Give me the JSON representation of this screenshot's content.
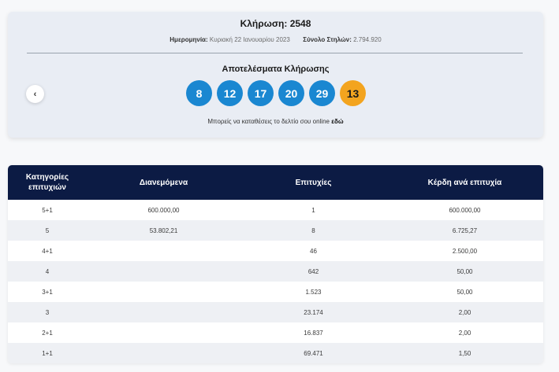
{
  "draw": {
    "title": "Κλήρωση: 2548",
    "date_label": "Ημερομηνία:",
    "date_value": "Κυριακή 22 Ιανουαρίου 2023",
    "columns_label": "Σύνολο Στηλών:",
    "columns_value": "2.794.920",
    "results_title": "Αποτελέσματα Κλήρωσης",
    "numbers": [
      "8",
      "12",
      "17",
      "20",
      "29"
    ],
    "joker": "13",
    "online_text": "Μπορείς να καταθέσεις το δελτίο σου online",
    "online_link": "εδώ",
    "prev_icon": "‹"
  },
  "colors": {
    "ball": "#1a87d1",
    "joker": "#f3a41f",
    "table_header": "#0c1b44"
  },
  "table": {
    "headers": {
      "h1_line1": "Κατηγορίες",
      "h1_line2": "επιτυχιών",
      "h2": "Διανεμόμενα",
      "h3": "Επιτυχίες",
      "h4": "Κέρδη ανά επιτυχία"
    },
    "rows": [
      {
        "category": "5+1",
        "distributed": "600.000,00",
        "winners": "1",
        "prize": "600.000,00"
      },
      {
        "category": "5",
        "distributed": "53.802,21",
        "winners": "8",
        "prize": "6.725,27"
      },
      {
        "category": "4+1",
        "distributed": "",
        "winners": "46",
        "prize": "2.500,00"
      },
      {
        "category": "4",
        "distributed": "",
        "winners": "642",
        "prize": "50,00"
      },
      {
        "category": "3+1",
        "distributed": "",
        "winners": "1.523",
        "prize": "50,00"
      },
      {
        "category": "3",
        "distributed": "",
        "winners": "23.174",
        "prize": "2,00"
      },
      {
        "category": "2+1",
        "distributed": "",
        "winners": "16.837",
        "prize": "2,00"
      },
      {
        "category": "1+1",
        "distributed": "",
        "winners": "69.471",
        "prize": "1,50"
      }
    ]
  }
}
